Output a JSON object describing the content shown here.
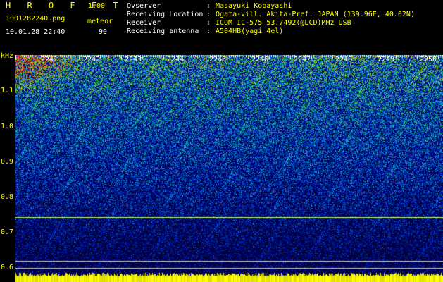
{
  "header": {
    "app_title": "H R O F F T",
    "version": "1.00",
    "filename": "1001282240.png",
    "mode": "meteor",
    "datetime": "10.01.28 22:40",
    "count": "90"
  },
  "info": [
    {
      "label": "Ovserver",
      "value": "Masayuki Kobayashi"
    },
    {
      "label": "Receiving Location",
      "value": "Ogata-vill. Akita-Pref. JAPAN (139.96E, 40.02N)"
    },
    {
      "label": "Receiver",
      "value": "ICOM IC-575 53.7492(@LCD)MHz USB"
    },
    {
      "label": "Receiving antenna",
      "value": "A504HB(yagi 4el)"
    }
  ],
  "separator": ":",
  "y_axis": {
    "unit": "kHz",
    "ticks": [
      "1.1",
      "1.0",
      "0.9",
      "0.8",
      "0.7",
      "0.6"
    ]
  },
  "x_axis": {
    "ticks": [
      "2241",
      "2242",
      "2243",
      "2244",
      "2245",
      "2246",
      "2247",
      "2248",
      "2249",
      "2250"
    ]
  },
  "colors": {
    "label": "#ffff00",
    "text": "#ffffff",
    "background": "#000000",
    "line": "#c8ff64"
  }
}
